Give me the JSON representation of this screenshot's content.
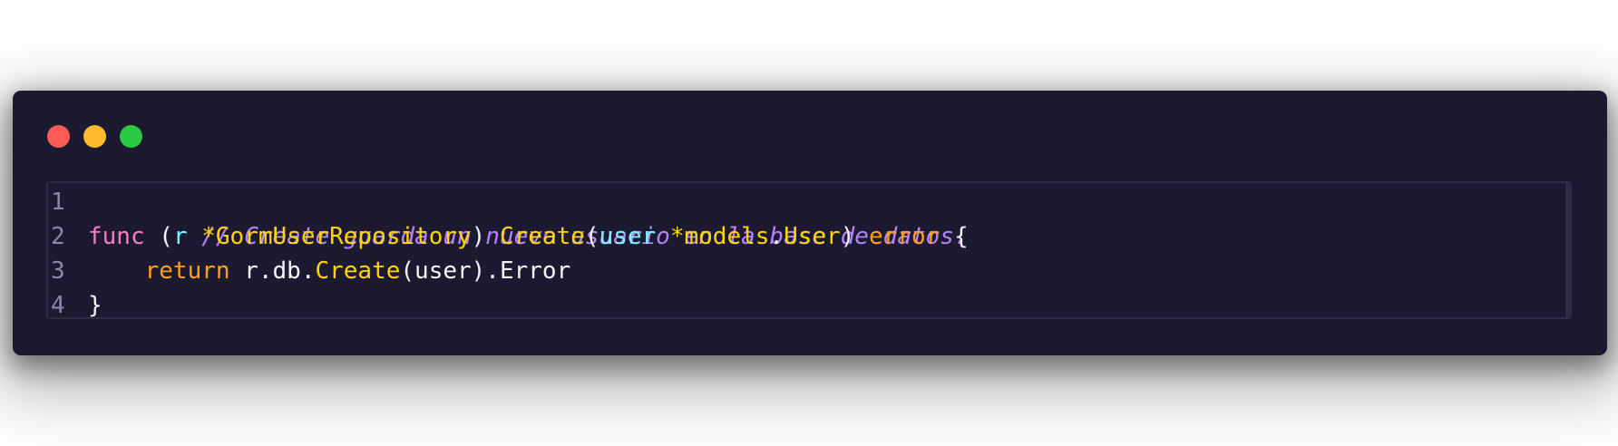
{
  "window": {
    "controls": {
      "close_color": "#ff5c57",
      "minimize_color": "#febc2e",
      "maximize_color": "#28c840"
    }
  },
  "code": {
    "line_numbers": [
      "1",
      "2",
      "3",
      "4"
    ],
    "lines": [
      {
        "tokens": [
          {
            "text": "// Create guarda un nuevo usuario en la base de datos.",
            "kind": "comment"
          }
        ]
      },
      {
        "tokens": [
          {
            "text": "func",
            "kind": "keyword"
          },
          {
            "text": " (",
            "kind": "plain"
          },
          {
            "text": "r",
            "kind": "param"
          },
          {
            "text": " ",
            "kind": "plain"
          },
          {
            "text": "*GormUserRepository",
            "kind": "type"
          },
          {
            "text": ") ",
            "kind": "plain"
          },
          {
            "text": "Create",
            "kind": "func"
          },
          {
            "text": "(",
            "kind": "plain"
          },
          {
            "text": "user",
            "kind": "param"
          },
          {
            "text": " ",
            "kind": "plain"
          },
          {
            "text": "*models",
            "kind": "type"
          },
          {
            "text": ".",
            "kind": "plain"
          },
          {
            "text": "User",
            "kind": "type"
          },
          {
            "text": ") ",
            "kind": "plain"
          },
          {
            "text": "error",
            "kind": "return"
          },
          {
            "text": " {",
            "kind": "plain"
          }
        ]
      },
      {
        "tokens": [
          {
            "text": "    ",
            "kind": "plain"
          },
          {
            "text": "return",
            "kind": "return"
          },
          {
            "text": " r.db.",
            "kind": "plain"
          },
          {
            "text": "Create",
            "kind": "func"
          },
          {
            "text": "(user).Error",
            "kind": "plain"
          }
        ]
      },
      {
        "tokens": [
          {
            "text": "}",
            "kind": "plain"
          }
        ]
      }
    ]
  }
}
